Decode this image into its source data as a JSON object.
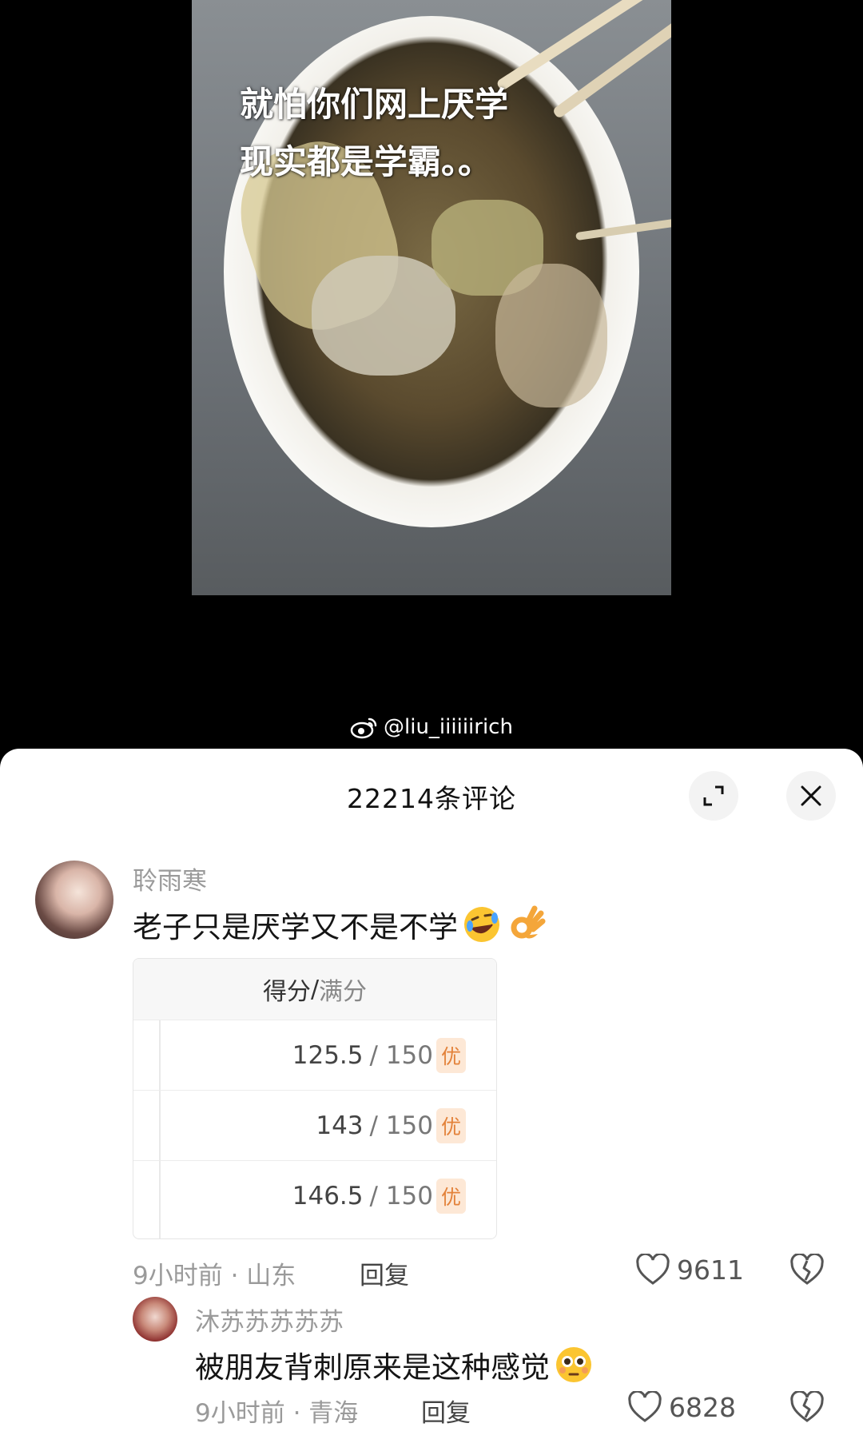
{
  "video": {
    "caption_line1": "就怕你们网上厌学",
    "caption_line2": "现实都是学霸。。",
    "watermark_handle": "@liu_iiiiiirich"
  },
  "comments_sheet": {
    "title": "22214条评论",
    "comments": [
      {
        "username": "聆雨寒",
        "text": "老子只是厌学又不是不学",
        "emojis": [
          "rolling-laughing-emoji",
          "ok-hand-emoji"
        ],
        "score_table": {
          "header_main": "得分",
          "header_sep": "/",
          "header_total": "满分",
          "rows": [
            {
              "score": "125.5",
              "total": "/ 150",
              "grade": "优"
            },
            {
              "score": "143",
              "total": "/ 150",
              "grade": "优"
            },
            {
              "score": "146.5",
              "total": "/ 150",
              "grade": "优"
            }
          ]
        },
        "time": "9小时前",
        "location": "· 山东",
        "reply_label": "回复",
        "likes": "9611"
      },
      {
        "username": "沐苏苏苏苏苏",
        "text": "被朋友背刺原来是这种感觉",
        "emojis": [
          "flushed-face-emoji"
        ],
        "time": "9小时前",
        "location": "· 青海",
        "reply_label": "回复",
        "likes": "6828"
      }
    ]
  },
  "colors": {
    "background_top": "#000000",
    "sheet_bg": "#ffffff",
    "grade_badge_bg": "#fde8d6",
    "grade_badge_text": "#e3823a",
    "muted_text": "#9a9a9a"
  }
}
